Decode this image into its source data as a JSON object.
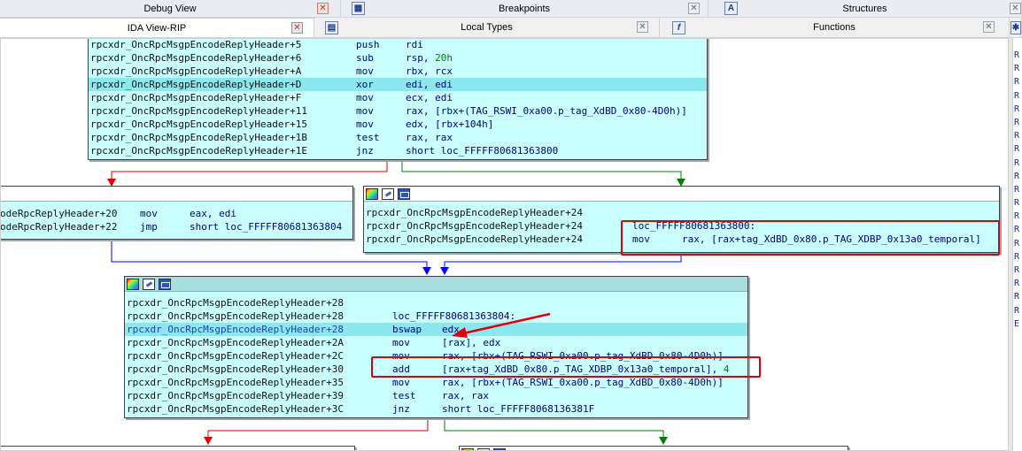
{
  "tabs_top": [
    {
      "label": "Debug View",
      "close": "red"
    },
    {
      "label": "Breakpoints",
      "icon": "breakpoints-icon"
    },
    {
      "label": "Structures",
      "icon": "structures-icon"
    }
  ],
  "tabs_second": [
    {
      "label": "IDA View-RIP",
      "close": "red"
    },
    {
      "label": "Local Types",
      "icon": "local-types-icon"
    },
    {
      "label": "Functions",
      "icon": "functions-icon",
      "icon_glyph": "f"
    }
  ],
  "node_top": {
    "rows": [
      {
        "addr": "rpcxdr_OncRpcMsgpEncodeReplyHeader+5",
        "mn": "push",
        "op": "rdi"
      },
      {
        "addr": "rpcxdr_OncRpcMsgpEncodeReplyHeader+6",
        "mn": "sub",
        "op": "rsp, ",
        "num": "20h"
      },
      {
        "addr": "rpcxdr_OncRpcMsgpEncodeReplyHeader+A",
        "mn": "mov",
        "op": "rbx, rcx"
      },
      {
        "addr": "rpcxdr_OncRpcMsgpEncodeReplyHeader+D",
        "mn": "xor",
        "op": "edi, edi",
        "highlight": true
      },
      {
        "addr": "rpcxdr_OncRpcMsgpEncodeReplyHeader+F",
        "mn": "mov",
        "op": "ecx, edi"
      },
      {
        "addr": "rpcxdr_OncRpcMsgpEncodeReplyHeader+11",
        "mn": "mov",
        "op": "rax, [rbx+(TAG_RSWI_0xa00.p_tag_XdBD_0x80-4D0h)]"
      },
      {
        "addr": "rpcxdr_OncRpcMsgpEncodeReplyHeader+15",
        "mn": "mov",
        "op": "edx, [rbx+104h]"
      },
      {
        "addr": "rpcxdr_OncRpcMsgpEncodeReplyHeader+1B",
        "mn": "test",
        "op": "rax, rax"
      },
      {
        "addr": "rpcxdr_OncRpcMsgpEncodeReplyHeader+1E",
        "mn": "jnz",
        "op": "short loc_FFFFF80681363800"
      }
    ]
  },
  "node_left": {
    "rows": [
      {
        "addr": "odeRpcReplyHeader+20",
        "mn": "mov",
        "op": "eax, edi"
      },
      {
        "addr": "odeRpcReplyHeader+22",
        "mn": "jmp",
        "op": "short loc_FFFFF80681363804"
      }
    ]
  },
  "node_right": {
    "rows": [
      {
        "addr": "rpcxdr_OncRpcMsgpEncodeReplyHeader+24",
        "mn": "",
        "op": ""
      },
      {
        "addr": "rpcxdr_OncRpcMsgpEncodeReplyHeader+24",
        "mn": "loc_FFFFF80681363800:",
        "op": ""
      },
      {
        "addr": "rpcxdr_OncRpcMsgpEncodeReplyHeader+24",
        "mn": "mov",
        "op": "rax, [rax+tag_XdBD_0x80.p_TAG_XDBP_0x13a0_temporal]"
      }
    ]
  },
  "node_main": {
    "rows": [
      {
        "addr": "rpcxdr_OncRpcMsgpEncodeReplyHeader+28",
        "mn": "",
        "op": ""
      },
      {
        "addr": "rpcxdr_OncRpcMsgpEncodeReplyHeader+28",
        "mn": "loc_FFFFF80681363804:",
        "op": ""
      },
      {
        "addr": "rpcxdr_OncRpcMsgpEncodeReplyHeader+28",
        "mn": "bswap",
        "op": "edx",
        "highlight": true,
        "blue": true
      },
      {
        "addr": "rpcxdr_OncRpcMsgpEncodeReplyHeader+2A",
        "mn": "mov",
        "op": "[rax], edx"
      },
      {
        "addr": "rpcxdr_OncRpcMsgpEncodeReplyHeader+2C",
        "mn": "mov",
        "op": "rax, [rbx+(TAG_RSWI_0xa00.p_tag_XdBD_0x80-4D0h)]"
      },
      {
        "addr": "rpcxdr_OncRpcMsgpEncodeReplyHeader+30",
        "mn": "add",
        "op": "[rax+tag_XdBD_0x80.p_TAG_XDBP_0x13a0_temporal], ",
        "num": "4"
      },
      {
        "addr": "rpcxdr_OncRpcMsgpEncodeReplyHeader+35",
        "mn": "mov",
        "op": "rax, [rbx+(TAG_RSWI_0xa00.p_tag_XdBD_0x80-4D0h)]"
      },
      {
        "addr": "rpcxdr_OncRpcMsgpEncodeReplyHeader+39",
        "mn": "test",
        "op": "rax, rax"
      },
      {
        "addr": "rpcxdr_OncRpcMsgpEncodeReplyHeader+3C",
        "mn": "jnz",
        "op": "short loc_FFFFF8068136381F"
      }
    ]
  },
  "right_pane_letters": [
    "R",
    "R",
    "R",
    "R",
    "R",
    "R",
    "R",
    "R",
    "R",
    "R",
    "R",
    "R",
    "R",
    "R",
    "R",
    "R",
    "R",
    "R",
    "R",
    "R",
    "E"
  ],
  "colors": {
    "node_bg": "#c9ffff",
    "highlight": "#8be8ee",
    "edge_false": "#e00000",
    "edge_true": "#008000",
    "edge_jump": "#0000ff",
    "annotation": "#e0000d"
  }
}
